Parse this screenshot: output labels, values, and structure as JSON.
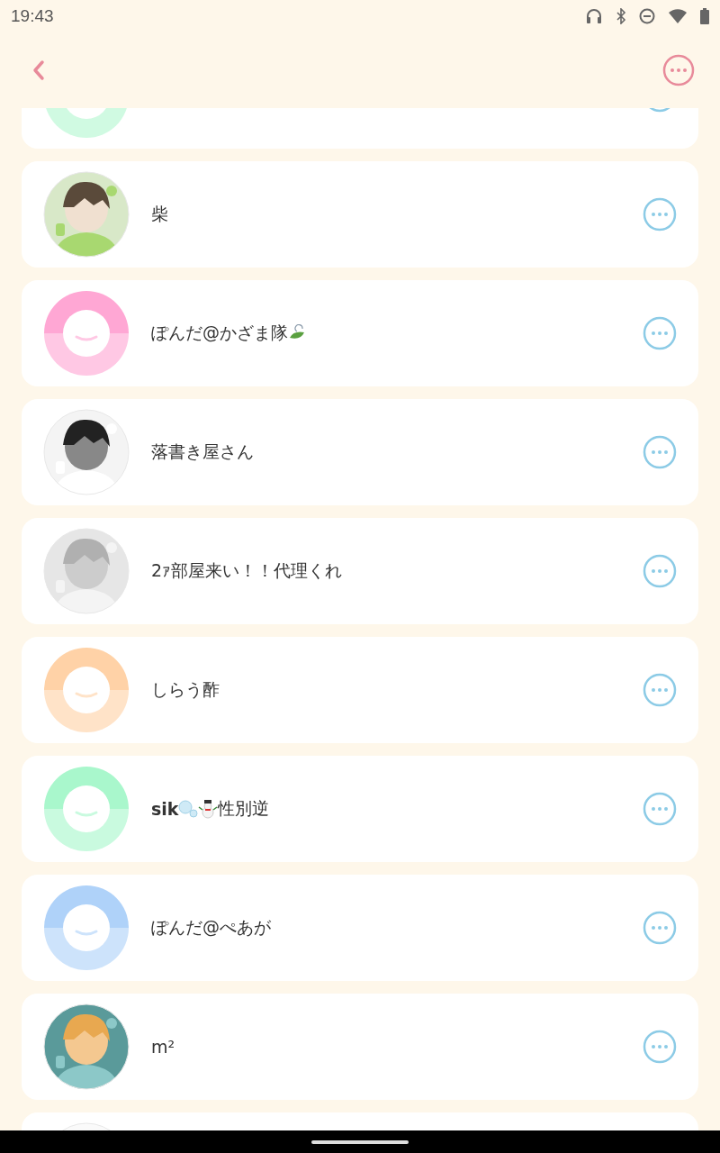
{
  "status_bar": {
    "time": "19:43"
  },
  "contacts": [
    {
      "avatar": {
        "kind": "default",
        "color": "#d0fae2"
      },
      "menu_visible": true
    },
    {
      "avatar": {
        "kind": "picture"
      },
      "name": [
        {
          "kind": "text",
          "text": "柴"
        }
      ],
      "menu_visible": true
    },
    {
      "avatar": {
        "kind": "default",
        "color": "#ffc8e4"
      },
      "name": [
        {
          "kind": "text",
          "text": "ぽんだ@かざま隊"
        },
        {
          "kind": "leaf"
        }
      ],
      "menu_visible": true
    },
    {
      "avatar": {
        "kind": "picture"
      },
      "name": [
        {
          "kind": "text",
          "text": "落書き屋さん"
        }
      ],
      "menu_visible": true
    },
    {
      "avatar": {
        "kind": "picture"
      },
      "name": [
        {
          "kind": "text",
          "text": "2ｧ部屋来い！！代理くれ"
        }
      ],
      "menu_visible": true
    },
    {
      "avatar": {
        "kind": "default",
        "color": "#ffe3c8"
      },
      "name": [
        {
          "kind": "text",
          "text": "しらう酢"
        }
      ],
      "menu_visible": true
    },
    {
      "avatar": {
        "kind": "default",
        "color": "#c9fadf"
      },
      "name": [
        {
          "kind": "text",
          "text": "**sik**"
        },
        {
          "kind": "bubbles"
        },
        {
          "kind": "snowman"
        },
        {
          "kind": "text",
          "text": "性別逆"
        }
      ],
      "menu_visible": true
    },
    {
      "avatar": {
        "kind": "default",
        "color": "#cde3fb"
      },
      "name": [
        {
          "kind": "text",
          "text": "ぽんだ@ぺあが"
        }
      ],
      "menu_visible": true
    },
    {
      "avatar": {
        "kind": "picture"
      },
      "name": [
        {
          "kind": "text",
          "text": "m²"
        }
      ],
      "menu_visible": true
    },
    {
      "avatar": {
        "kind": "picture"
      },
      "menu_visible": false
    }
  ]
}
